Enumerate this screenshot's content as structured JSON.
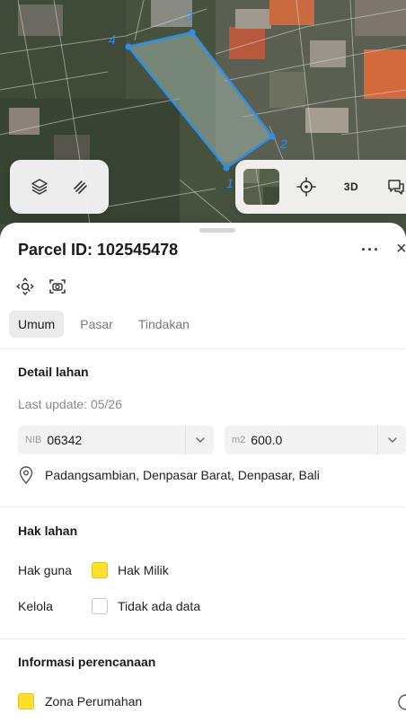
{
  "map": {
    "vertex_labels": [
      "1",
      "2",
      "3",
      "4"
    ],
    "toolbar_left": {
      "layers_icon": "layers-icon",
      "draw_icon": "draw-icon"
    },
    "toolbar_right": {
      "satellite_icon": "satellite-thumbnail",
      "locate_icon": "crosshair-icon",
      "label_3d": "3D",
      "chat_icon": "chat-icon"
    }
  },
  "parcel": {
    "title": "Parcel ID: 102545478",
    "more_label": "···",
    "close_label": "×"
  },
  "tabs": [
    {
      "label": "Umum",
      "active": true
    },
    {
      "label": "Pasar",
      "active": false
    },
    {
      "label": "Tindakan",
      "active": false
    }
  ],
  "detail": {
    "title": "Detail lahan",
    "last_update": "Last update: 05/26",
    "nib": {
      "prefix": "NIB",
      "value": "06342"
    },
    "area": {
      "prefix": "m2",
      "value": "600.0"
    },
    "address": "Padangsambian, Denpasar Barat, Denpasar, Bali"
  },
  "hak": {
    "title": "Hak lahan",
    "rows": [
      {
        "label": "Hak guna",
        "value": "Hak Milik",
        "swatch": "#ffe02e"
      },
      {
        "label": "Kelola",
        "value": "Tidak ada data",
        "swatch": "#ffffff"
      }
    ]
  },
  "planning": {
    "title": "Informasi perencanaan",
    "zone": "Zona Perumahan",
    "zone_color": "#ffe02e"
  }
}
